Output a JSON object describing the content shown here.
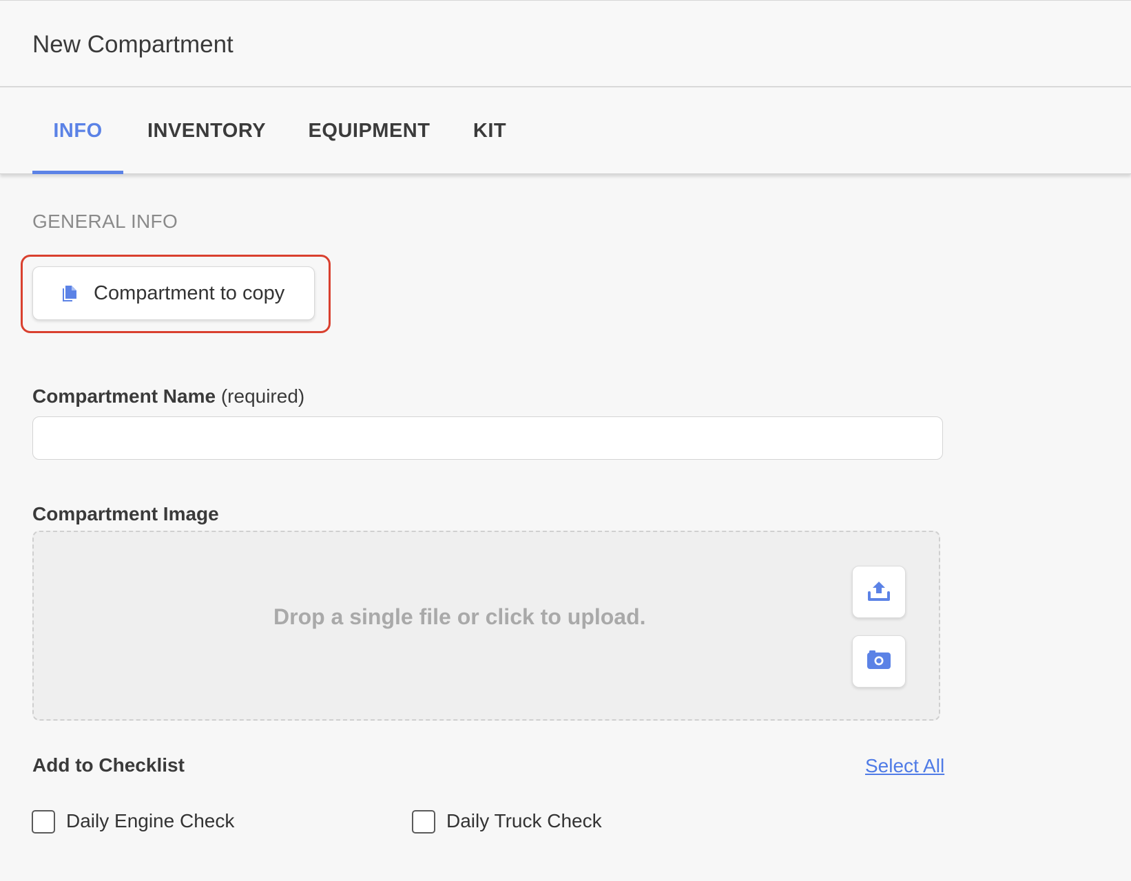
{
  "header": {
    "title": "New Compartment"
  },
  "tabs": [
    {
      "label": "INFO",
      "active": true
    },
    {
      "label": "INVENTORY",
      "active": false
    },
    {
      "label": "EQUIPMENT",
      "active": false
    },
    {
      "label": "KIT",
      "active": false
    }
  ],
  "general_info": {
    "section_label": "GENERAL INFO",
    "copy_button_label": "Compartment to copy",
    "copy_icon": "file-copy-icon"
  },
  "name_field": {
    "label": "Compartment Name",
    "required_note": "(required)",
    "value": "",
    "placeholder": ""
  },
  "image_field": {
    "label": "Compartment Image",
    "dropzone_text": "Drop a single file or click to upload.",
    "upload_icon": "upload-icon",
    "camera_icon": "camera-icon"
  },
  "checklist": {
    "title": "Add to Checklist",
    "select_all_label": "Select All",
    "items": [
      {
        "label": "Daily Engine Check",
        "checked": false
      },
      {
        "label": "Daily Truck Check",
        "checked": false
      }
    ]
  },
  "colors": {
    "accent": "#5b82e6",
    "highlight": "#d9402f",
    "link": "#4f7be6"
  }
}
